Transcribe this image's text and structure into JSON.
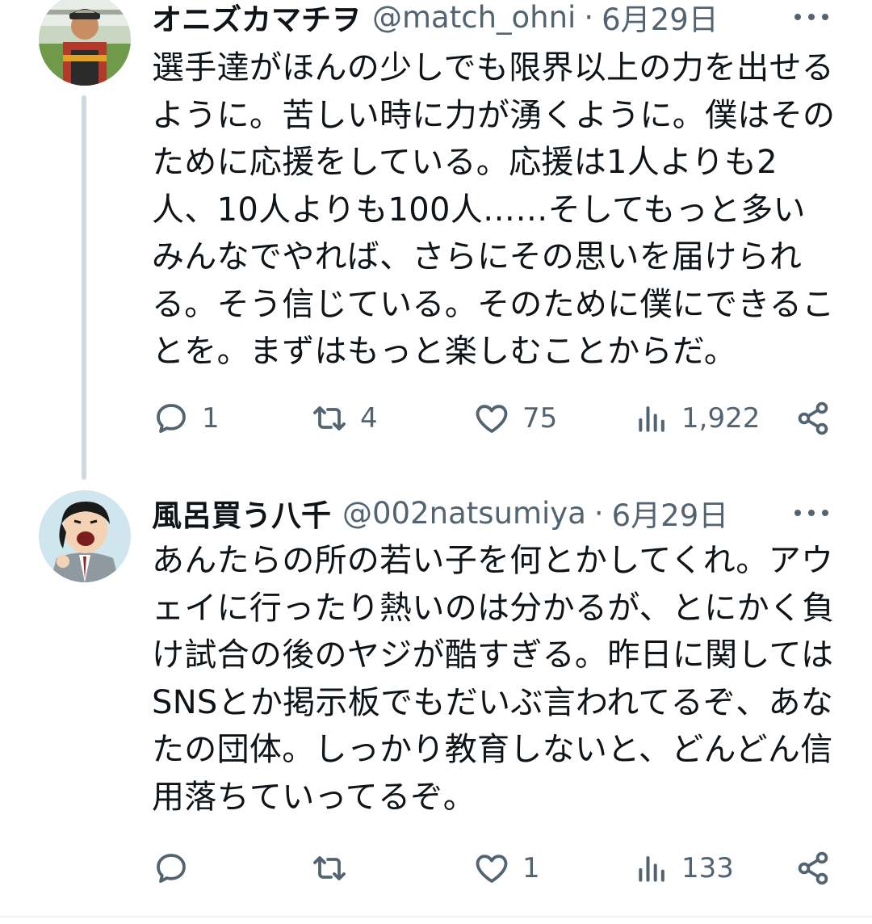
{
  "tweets": [
    {
      "display_name": "オニズカマチヲ",
      "handle": "@match_ohni",
      "separator": "·",
      "date": "6月29日",
      "text": "選手達がほんの少しでも限界以上の力を出せるように。苦しい時に力が湧くように。僕はそのために応援をしている。応援は1人よりも2人、10人よりも100人……そしてもっと多いみんなでやれば、さらにその思いを届けられる。そう信じている。そのために僕にできることを。まずはもっと楽しむことからだ。",
      "replies": "1",
      "retweets": "4",
      "likes": "75",
      "views": "1,922",
      "avatar_icon": "user-photo-avatar"
    },
    {
      "display_name": "風呂買う八千",
      "handle": "@002natsumiya",
      "separator": "·",
      "date": "6月29日",
      "text": "あんたらの所の若い子を何とかしてくれ。アウェイに行ったり熱いのは分かるが、とにかく負け試合の後のヤジが酷すぎる。昨日に関してはSNSとか掲示板でもだいぶ言われてるぞ、あなたの団体。しっかり教育しないと、どんどん信用落ちていってるぞ。",
      "replies": "",
      "retweets": "",
      "likes": "1",
      "views": "133",
      "avatar_icon": "cartoon-character-avatar"
    }
  ],
  "colors": {
    "text": "#0f1419",
    "secondary": "#536471",
    "thread_line": "#cfd9de"
  }
}
